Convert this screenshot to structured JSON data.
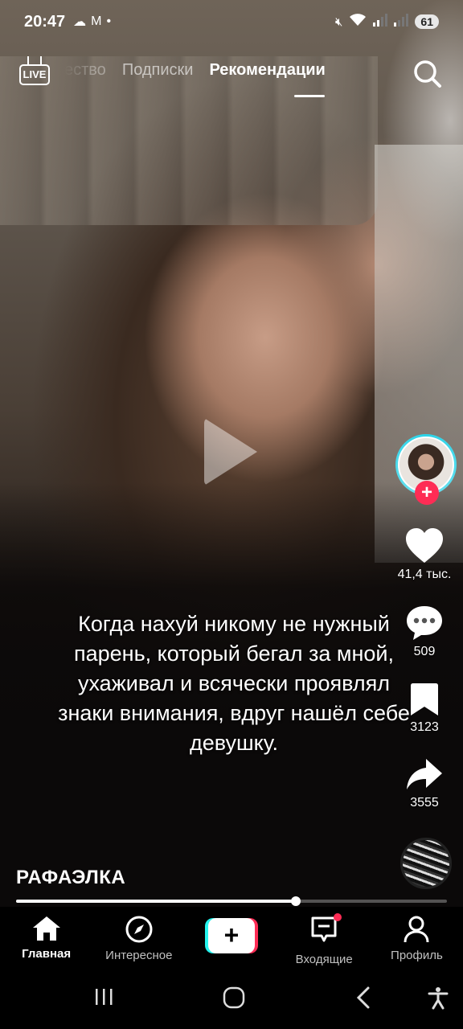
{
  "status_bar": {
    "time": "20:47",
    "battery": "61",
    "left_icons": [
      "weather-icon",
      "cloud-icon",
      "mail-icon",
      "dot-icon"
    ],
    "right_icons": [
      "mute-icon",
      "wifi-icon",
      "signal-icon",
      "signal-icon"
    ]
  },
  "top_bar": {
    "live_label": "LIVE",
    "tabs": [
      {
        "label": "ество",
        "active": false
      },
      {
        "label": "Подписки",
        "active": false
      },
      {
        "label": "Рекомендации",
        "active": true
      }
    ]
  },
  "video": {
    "caption": "Когда нахуй никому не нужный парень, который бегал за мной, ухаживал и всячески проявлял знаки внимания, вдруг нашёл себе девушку.",
    "author": "РАФАЭЛКА",
    "progress_percent": 65,
    "paused": true
  },
  "actions": {
    "likes": "41,4 тыс.",
    "comments": "509",
    "favorites": "3123",
    "shares": "3555"
  },
  "bottom_nav": {
    "items": [
      {
        "label": "Главная",
        "icon": "home-icon",
        "active": true
      },
      {
        "label": "Интересное",
        "icon": "compass-icon",
        "active": false
      },
      {
        "label": "",
        "icon": "create-plus-icon",
        "active": false
      },
      {
        "label": "Входящие",
        "icon": "inbox-icon",
        "active": false
      },
      {
        "label": "Профиль",
        "icon": "profile-icon",
        "active": false
      }
    ]
  },
  "colors": {
    "accent_red": "#fe2c55",
    "accent_cyan": "#25f4ee"
  }
}
